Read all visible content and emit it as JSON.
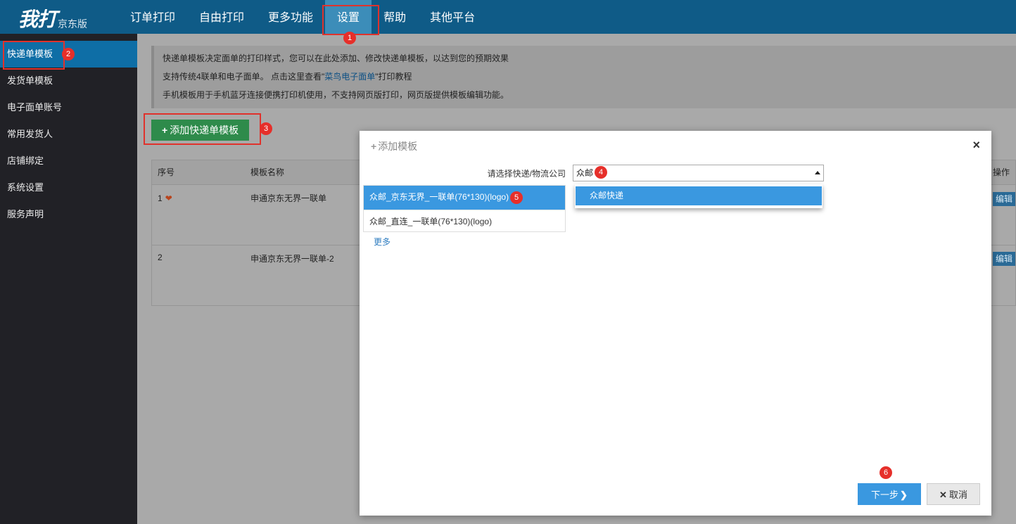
{
  "logo": {
    "main": "我打",
    "sub": "京东版"
  },
  "nav": [
    {
      "label": "订单打印"
    },
    {
      "label": "自由打印"
    },
    {
      "label": "更多功能"
    },
    {
      "label": "设置"
    },
    {
      "label": "帮助"
    },
    {
      "label": "其他平台"
    }
  ],
  "sidebar": [
    {
      "label": "快递单模板"
    },
    {
      "label": "发货单模板"
    },
    {
      "label": "电子面单账号"
    },
    {
      "label": "常用发货人"
    },
    {
      "label": "店铺绑定"
    },
    {
      "label": "系统设置"
    },
    {
      "label": "服务声明"
    }
  ],
  "info": {
    "line1": "快递单模板决定面单的打印样式，您可以在此处添加、修改快递单模板，以达到您的预期效果",
    "line2_pre": "支持传统4联单和电子面单。 点击这里查看\"",
    "line2_link": "菜鸟电子面单",
    "line2_post": "\"打印教程",
    "line3": "手机模板用于手机蓝牙连接便携打印机使用，不支持网页版打印，网页版提供模板编辑功能。"
  },
  "add_button": {
    "icon": "+",
    "label": "添加快递单模板"
  },
  "table": {
    "headers": {
      "index": "序号",
      "name": "模板名称",
      "op": "操作"
    },
    "rows": [
      {
        "index": "1",
        "name": "申通京东无界一联单",
        "edit": "编辑"
      },
      {
        "index": "2",
        "name": "申通京东无界一联单-2",
        "edit": "编辑"
      }
    ]
  },
  "modal": {
    "title": "添加模板",
    "close": "×",
    "company_label": "请选择快递/物流公司",
    "company_value": "众邮",
    "dropdown_option": "众邮快递",
    "templates": [
      {
        "label": "众邮_京东无界_一联单(76*130)(logo)"
      },
      {
        "label": "众邮_直连_一联单(76*130)(logo)"
      }
    ],
    "more": "更多",
    "next": "下一步",
    "next_icon": "❯",
    "cancel": "取消",
    "cancel_icon": "✕"
  },
  "badges": [
    "1",
    "2",
    "3",
    "4",
    "5",
    "6"
  ],
  "colors": {
    "header": "#0f5b87",
    "sidebar": "#212126",
    "accent": "#3a98e0",
    "annotation": "#e62f2a",
    "add_button": "#2e8b4b"
  }
}
